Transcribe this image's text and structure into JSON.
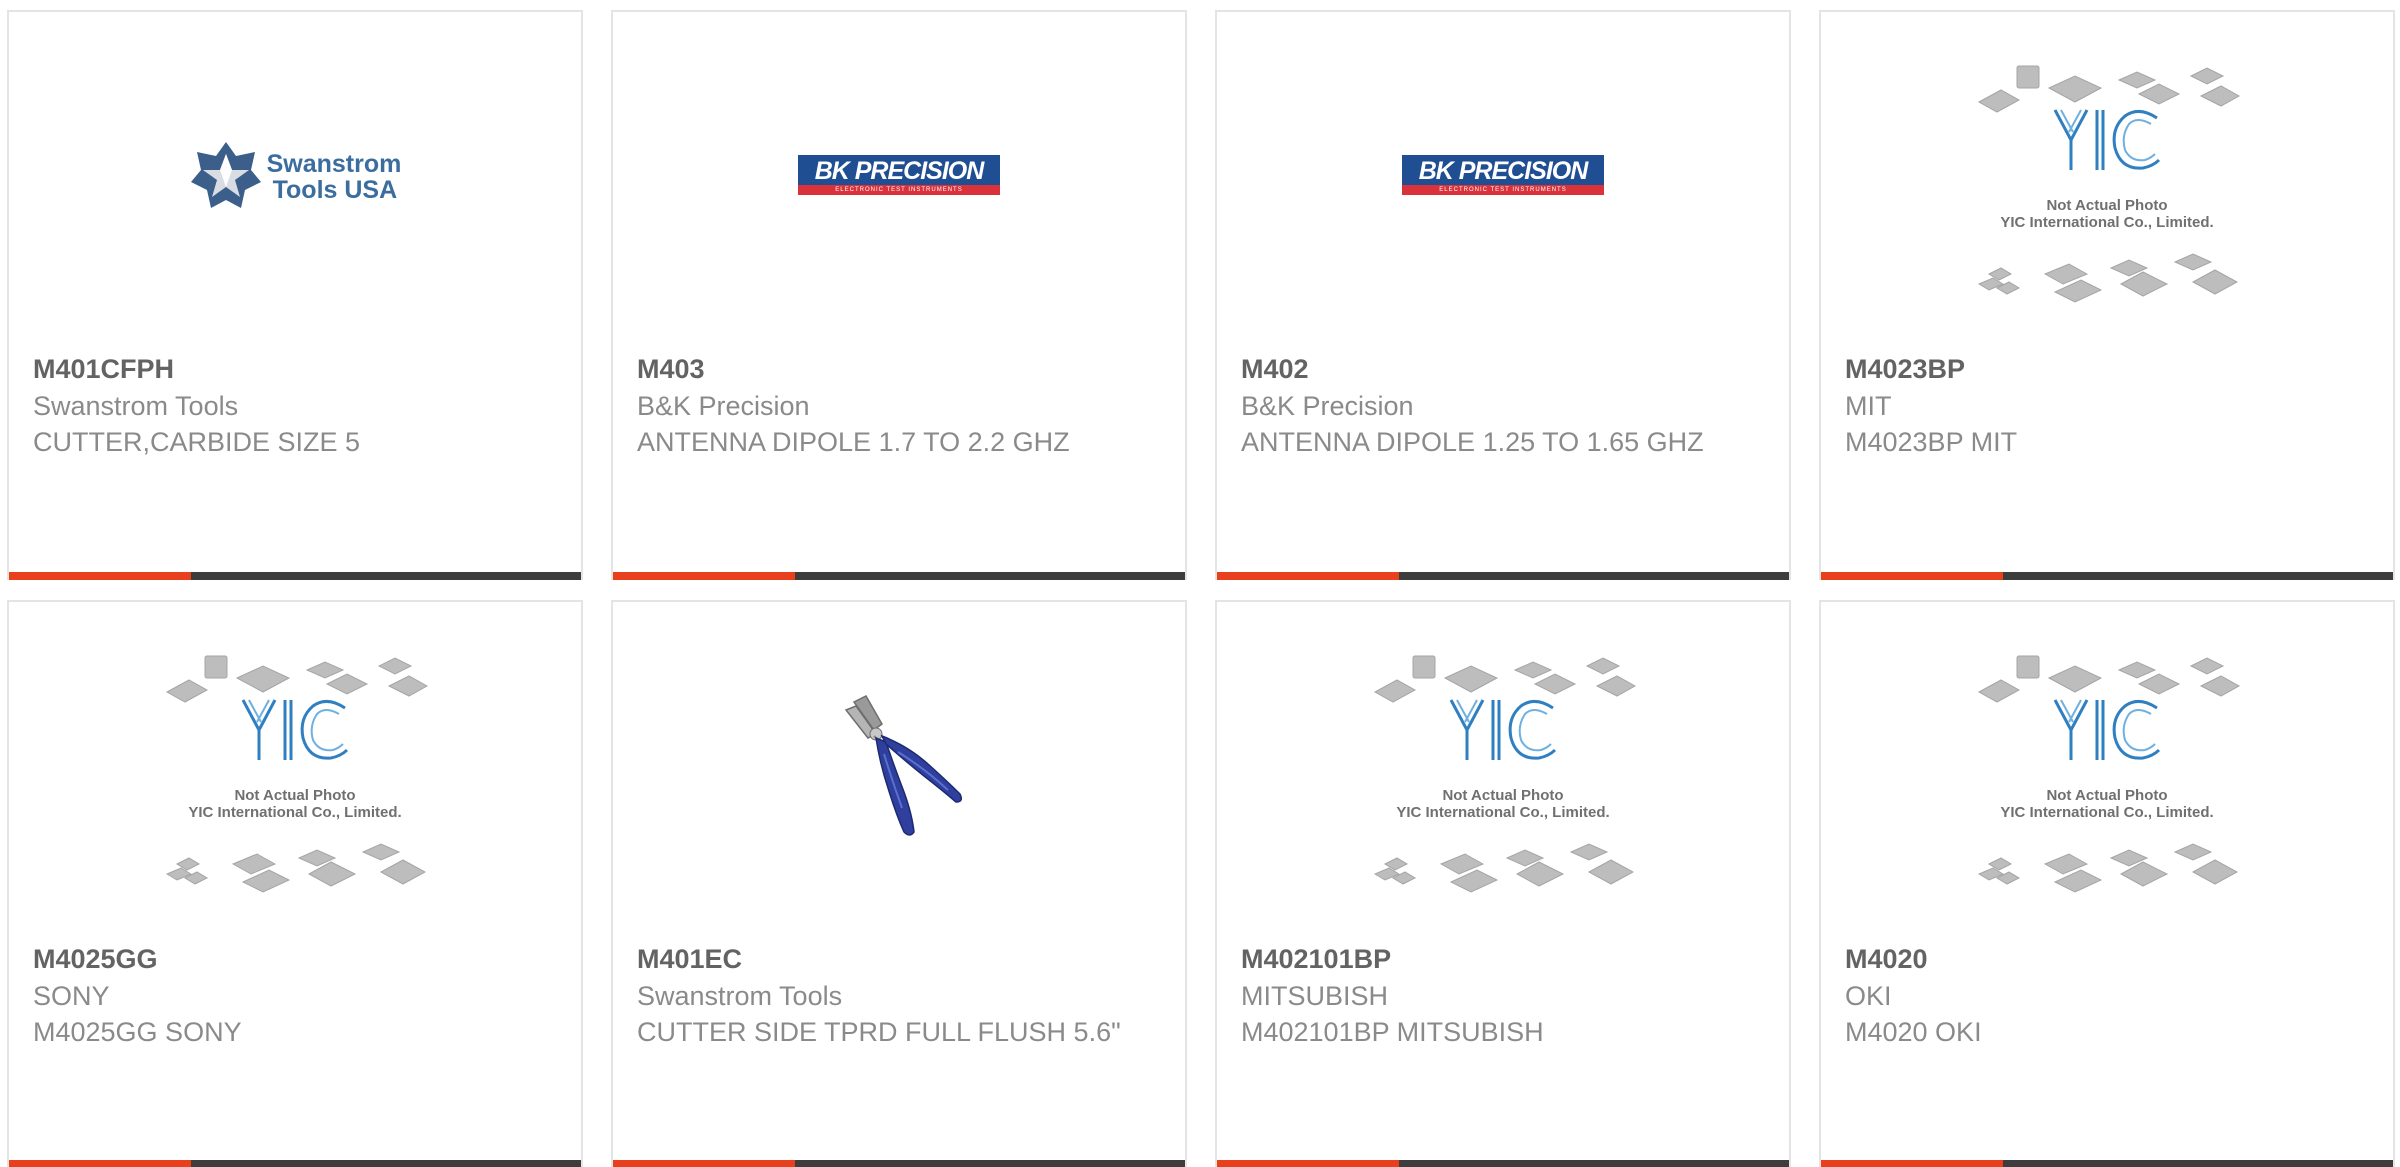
{
  "products": [
    {
      "part": "M401CFPH",
      "brand": "Swanstrom Tools",
      "desc": "CUTTER,CARBIDE SIZE 5",
      "image": "swanstrom-logo"
    },
    {
      "part": "M403",
      "brand": "B&K Precision",
      "desc": "ANTENNA DIPOLE 1.7 TO 2.2 GHZ",
      "image": "bk-precision-logo"
    },
    {
      "part": "M402",
      "brand": "B&K Precision",
      "desc": "ANTENNA DIPOLE 1.25 TO 1.65 GHZ",
      "image": "bk-precision-logo"
    },
    {
      "part": "M4023BP",
      "brand": "MIT",
      "desc": "M4023BP MIT",
      "image": "yic-placeholder"
    },
    {
      "part": "M4025GG",
      "brand": "SONY",
      "desc": "M4025GG SONY",
      "image": "yic-placeholder"
    },
    {
      "part": "M401EC",
      "brand": "Swanstrom Tools",
      "desc": "CUTTER SIDE TPRD FULL FLUSH 5.6\"",
      "image": "pliers-photo"
    },
    {
      "part": "M402101BP",
      "brand": "MITSUBISH",
      "desc": "M402101BP MITSUBISH",
      "image": "yic-placeholder"
    },
    {
      "part": "M4020",
      "brand": "OKI",
      "desc": "M4020 OKI",
      "image": "yic-placeholder"
    }
  ],
  "logos": {
    "swanstrom_line1": "Swanstrom",
    "swanstrom_line2": "Tools USA",
    "bk_name": "BK PRECISION",
    "bk_sub": "ELECTRONIC TEST INSTRUMENTS",
    "yic_line1": "Not Actual Photo",
    "yic_line2": "YIC International Co., Limited."
  },
  "colors": {
    "accent": "#e8401c",
    "bar": "#3d3d3d",
    "part_text": "#636363",
    "body_text": "#8a8a8a"
  }
}
